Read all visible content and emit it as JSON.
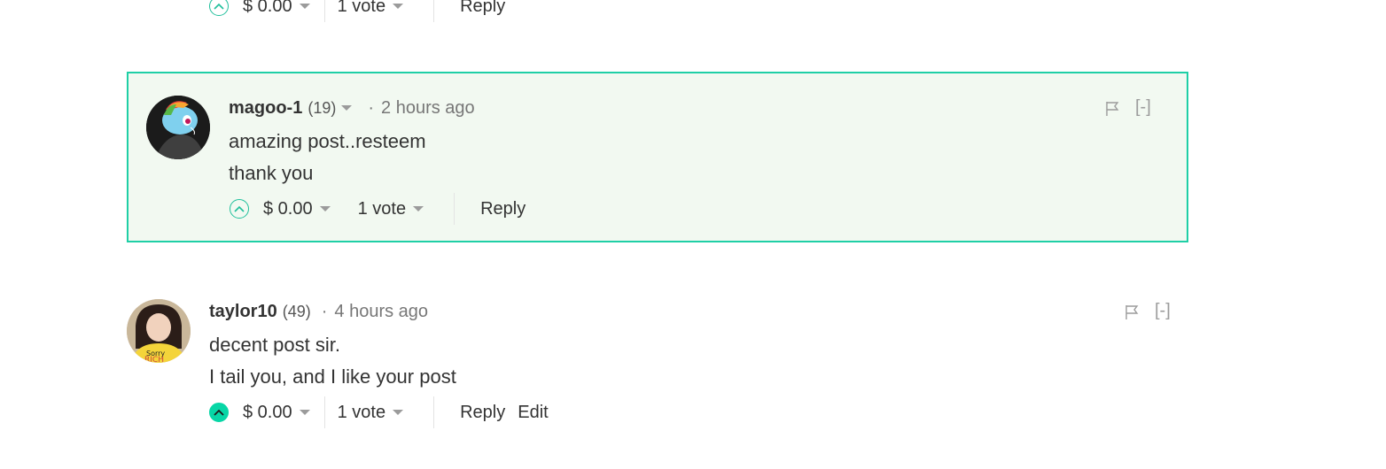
{
  "top_comment_actions": {
    "payout": "$ 0.00",
    "votes": "1 vote",
    "reply": "Reply"
  },
  "comments": [
    {
      "author": "magoo-1",
      "reputation": "(19)",
      "dot": "·",
      "time": "2 hours ago",
      "lines": [
        "amazing post..resteem",
        "thank you"
      ],
      "payout": "$ 0.00",
      "votes": "1 vote",
      "reply": "Reply",
      "collapse": "[-]"
    },
    {
      "author": "taylor10",
      "reputation": "(49)",
      "dot": "·",
      "time": "4 hours ago",
      "lines": [
        "decent post sir.",
        "I tail you, and I like your post"
      ],
      "payout": "$ 0.00",
      "votes": "1 vote",
      "reply": "Reply",
      "edit": "Edit",
      "collapse": "[-]"
    }
  ],
  "colors": {
    "accent": "#1fcfa6",
    "highlight_bg": "#f2f9f1",
    "upvoted": "#07d6a6"
  },
  "icons": {
    "upvote": "chevron-up-circle-icon",
    "dropdown": "caret-down-icon",
    "flag": "flag-icon"
  }
}
